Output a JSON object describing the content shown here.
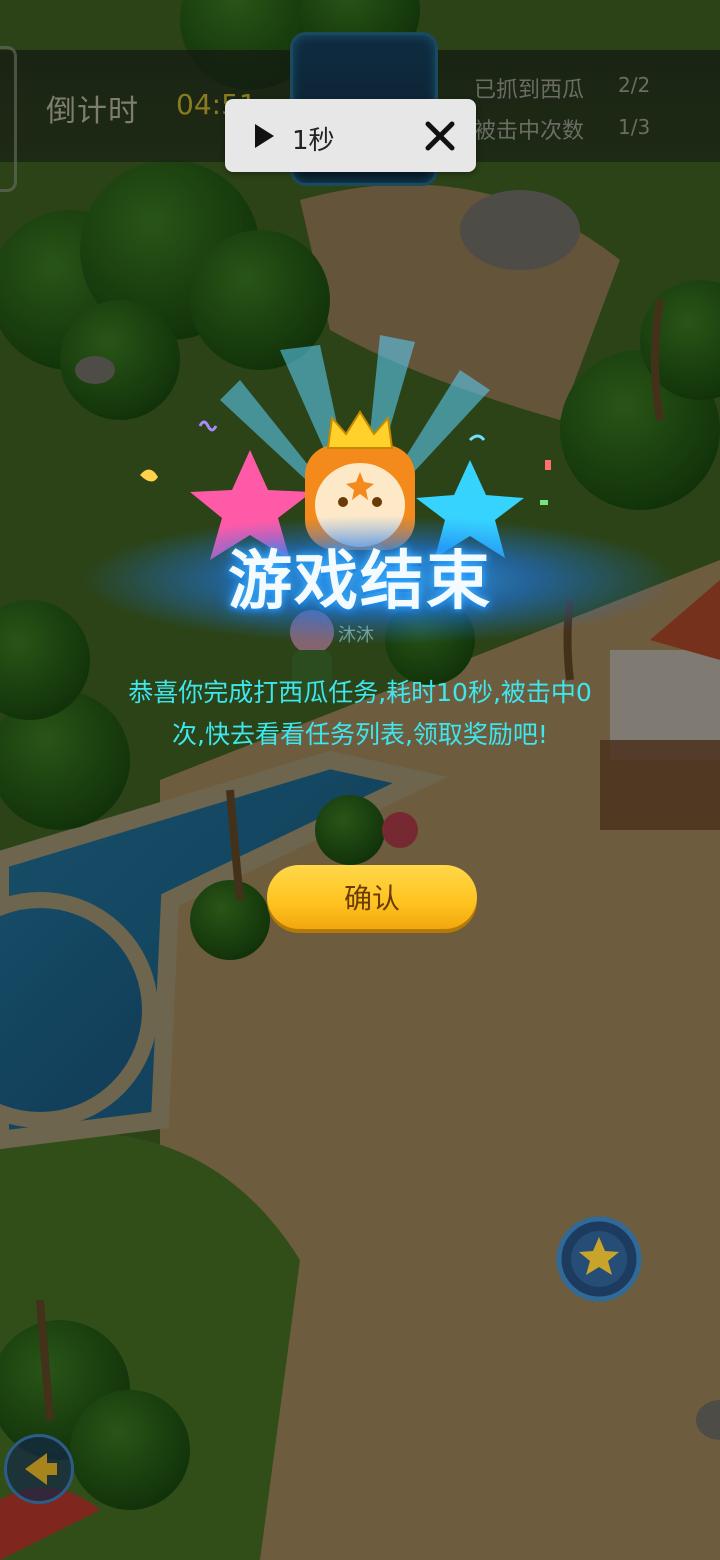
{
  "hud": {
    "countdown_label": "倒计时",
    "countdown_value": "04:51",
    "stats": [
      {
        "label": "已抓到西瓜",
        "value": "2/2"
      },
      {
        "label": "被击中次数",
        "value": "1/3"
      }
    ]
  },
  "toast": {
    "icon": "play-icon",
    "text": "1秒",
    "close_icon": "close-icon"
  },
  "dialog": {
    "title": "游戏结束",
    "message": "恭喜你完成打西瓜任务,耗时10秒,被击中0次,快去看看任务列表,领取奖励吧!",
    "confirm_label": "确认"
  },
  "scene": {
    "player_name": "沐沐"
  },
  "colors": {
    "message": "#3ee6ee",
    "button": "#ffc21f",
    "title_glow": "#1d8cff"
  }
}
